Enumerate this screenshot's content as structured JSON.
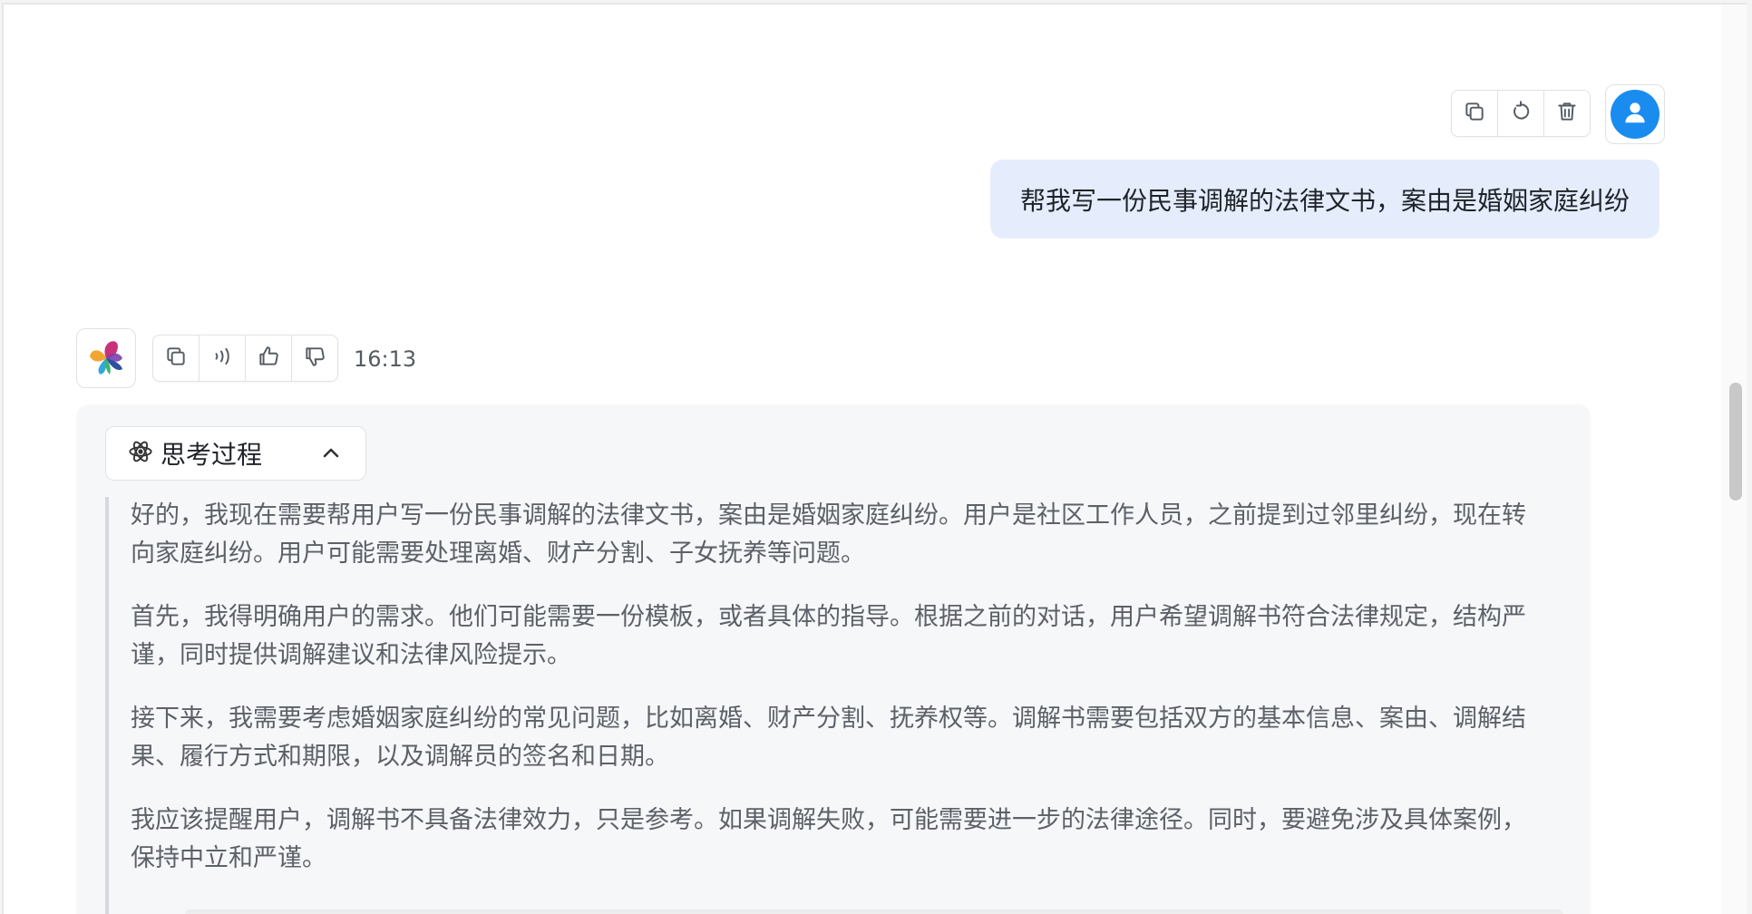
{
  "user_message": {
    "text": "帮我写一份民事调解的法律文书，案由是婚姻家庭纠纷",
    "actions": [
      "copy-icon",
      "regenerate-icon",
      "delete-icon"
    ],
    "avatar": "user-icon"
  },
  "assistant_message": {
    "avatar": "butterfly-logo",
    "actions": [
      "copy-icon",
      "speaker-icon",
      "thumbs-up-icon",
      "thumbs-down-icon"
    ],
    "time": "16:13",
    "thinking": {
      "label": "思考过程",
      "expanded": true,
      "paragraphs": [
        "好的，我现在需要帮用户写一份民事调解的法律文书，案由是婚姻家庭纠纷。用户是社区工作人员，之前提到过邻里纠纷，现在转向家庭纠纷。用户可能需要处理离婚、财产分割、子女抚养等问题。",
        "首先，我得明确用户的需求。他们可能需要一份模板，或者具体的指导。根据之前的对话，用户希望调解书符合法律规定，结构严谨，同时提供调解建议和法律风险提示。",
        "接下来，我需要考虑婚姻家庭纠纷的常见问题，比如离婚、财产分割、抚养权等。调解书需要包括双方的基本信息、案由、调解结果、履行方式和期限，以及调解员的签名和日期。",
        "我应该提醒用户，调解书不具备法律效力，只是参考。如果调解失败，可能需要进一步的法律途径。同时，要避免涉及具体案例，保持中立和严谨。"
      ]
    }
  },
  "colors": {
    "user_bubble": "#e5edfd",
    "user_avatar": "#1a8cf0",
    "thinking_panel": "#f6f7f9",
    "thinking_text": "#5c6168"
  }
}
